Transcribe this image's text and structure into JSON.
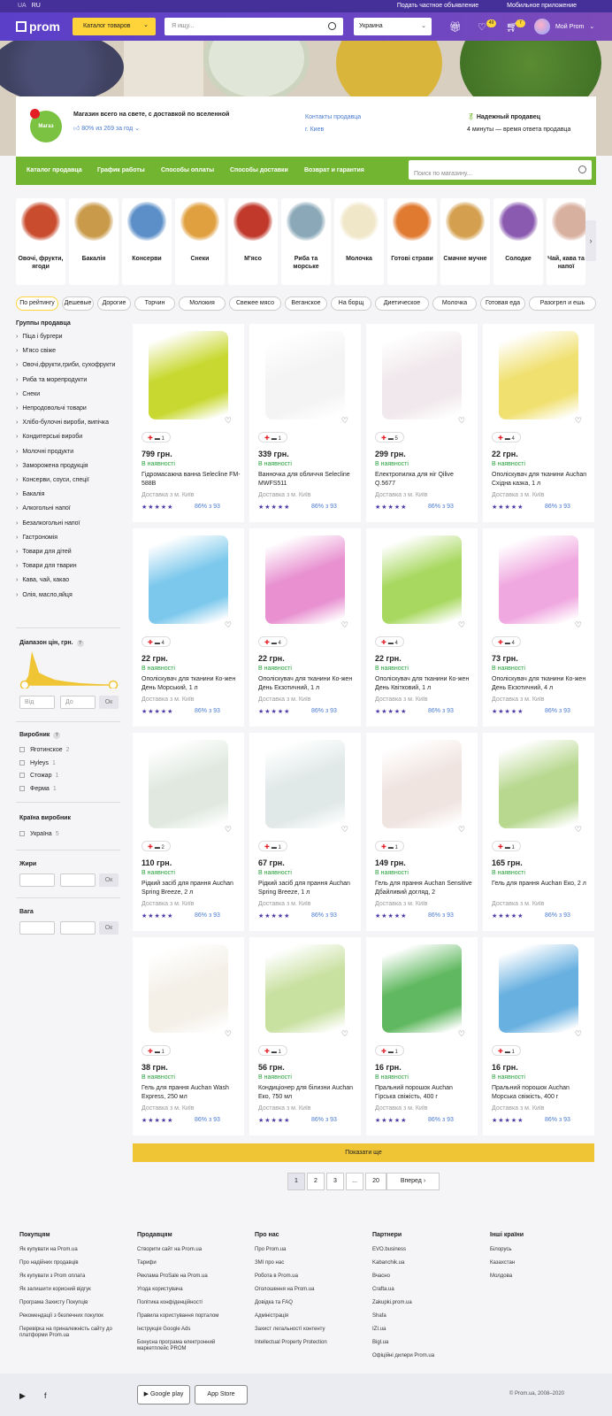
{
  "topbar": {
    "lang": [
      "UA",
      "RU"
    ],
    "sell": "Подать частное объявление",
    "app": "Мобильное приложение"
  },
  "header": {
    "logo": "prom",
    "catalog": "Каталог товаров",
    "search_ph": "Я ищу...",
    "region": "Украина",
    "favorites_count": "49",
    "cart_count": "7",
    "myprom": "Мой Prom"
  },
  "shop": {
    "logo_text": "Магаз",
    "name": "Магазин всего на свете, с доставкой по вселенной",
    "rating": "80% из 269 за год",
    "contacts": "Контакты продавца",
    "city": "г. Киев",
    "trusted": "Надежный продавец",
    "response": "4 минуты — время ответа продавца"
  },
  "shopnav": {
    "items": [
      "Каталог продавца",
      "График работы",
      "Способы оплаты",
      "Способы доставки",
      "Возврат и гарантия"
    ],
    "search_ph": "Поиск по магазину..."
  },
  "categories": [
    {
      "label": "Овочі, фрукти, ягоди",
      "color": "#c94c2e"
    },
    {
      "label": "Бакалія",
      "color": "#c89a4a"
    },
    {
      "label": "Консерви",
      "color": "#5c8fc8"
    },
    {
      "label": "Снеки",
      "color": "#e0a040"
    },
    {
      "label": "М'ясо",
      "color": "#c0392b"
    },
    {
      "label": "Риба та морське",
      "color": "#8aa8b8"
    },
    {
      "label": "Молочка",
      "color": "#f0e6c8"
    },
    {
      "label": "Готові страви",
      "color": "#e07a30"
    },
    {
      "label": "Смачне мучне",
      "color": "#d4a050"
    },
    {
      "label": "Солодке",
      "color": "#8a5ab0"
    },
    {
      "label": "Чай, кава та напої",
      "color": "#d8b0a0"
    }
  ],
  "chips": [
    "По рейтингу",
    "Дешевые",
    "Дорогие",
    "Торчин",
    "Молокия",
    "Свежее мясо",
    "Веганское",
    "На борщ",
    "Диетическое",
    "Молочка",
    "Готовая еда",
    "Разогрел и ешь"
  ],
  "sidebar": {
    "groups_title": "Группы продавца",
    "groups": [
      "Піца і бургери",
      "М'ясо свіже",
      "Овочі,фрукти,гриби, сухофрукти",
      "Риба та морепродукти",
      "Снеки",
      "Непродовольчі товари",
      "Хлібо-булочні вироби, випічка",
      "Кондитерські вироби",
      "Молочні продукти",
      "Заморожена продукція",
      "Консерви, соуси, спеції",
      "Бакалія",
      "Алкогольні напої",
      "Безалкогольні напої",
      "Гастрономія",
      "Товари для дітей",
      "Товари для тварин",
      "Кава, чай, какао",
      "Олія, масло,яйця"
    ],
    "price_title": "Діапазон цін, грн.",
    "from": "Від",
    "to": "До",
    "ok": "Ок",
    "maker_title": "Виробник",
    "makers": [
      {
        "n": "Яготинское",
        "c": "2"
      },
      {
        "n": "Hyleys",
        "c": "1"
      },
      {
        "n": "Стожар",
        "c": "1"
      },
      {
        "n": "Ферма",
        "c": "1"
      }
    ],
    "country_title": "Країна виробник",
    "countries": [
      {
        "n": "Україна",
        "c": "5"
      }
    ],
    "fat_title": "Жири",
    "weight_title": "Вага"
  },
  "products": [
    {
      "price": "799 грн.",
      "name": "Гідромасажна ванна Selecline FM-588B",
      "badge": "1",
      "img": "#c8d830"
    },
    {
      "price": "339 грн.",
      "name": "Ванночка для обличчя Selecline MWFS511",
      "badge": "1",
      "img": "#f4f4f4"
    },
    {
      "price": "299 грн.",
      "name": "Електропилка для ніг Qilive Q.5677",
      "badge": "5",
      "img": "#f0e8ec"
    },
    {
      "price": "22 грн.",
      "name": "Ополіскувач для тканини Auchan Східна казка, 1 л",
      "badge": "4",
      "img": "#f0e070"
    },
    {
      "price": "22 грн.",
      "name": "Ополіскувач для тканини Ко-жен День Морський, 1 л",
      "badge": "4",
      "img": "#7cc8ec"
    },
    {
      "price": "22 грн.",
      "name": "Ополіскувач для тканини Ко-жен День Екзотичний, 1 л",
      "badge": "4",
      "img": "#e890d0"
    },
    {
      "price": "22 грн.",
      "name": "Ополіскувач для тканини Ко-жен День Квітковий, 1 л",
      "badge": "4",
      "img": "#a8d860"
    },
    {
      "price": "73 грн.",
      "name": "Ополіскувач для тканини Ко-жен День Екзотичний, 4 л",
      "badge": "4",
      "img": "#f0a8e0"
    },
    {
      "price": "110 грн.",
      "name": "Рідкий засіб для прання Auchan Spring Breeze, 2 л",
      "badge": "2",
      "img": "#e0e8e0"
    },
    {
      "price": "67 грн.",
      "name": "Рідкий засіб для прання Auchan Spring Breeze, 1 л",
      "badge": "1",
      "img": "#e0e8e8"
    },
    {
      "price": "149 грн.",
      "name": "Гель для прання Auchan Sensitive Дбайливий догляд, 2",
      "badge": "1",
      "img": "#f0e4e0"
    },
    {
      "price": "165 грн.",
      "name": "Гель для прання Auchan Еко, 2 л",
      "badge": "1",
      "img": "#b8d890"
    },
    {
      "price": "38 грн.",
      "name": "Гель для прання Auchan Wash Express, 250 мл",
      "badge": "1",
      "img": "#f4f0e8"
    },
    {
      "price": "56 грн.",
      "name": "Кондиціонер для білизни Auchan Еко, 750 мл",
      "badge": "1",
      "img": "#c8e0a0"
    },
    {
      "price": "16 грн.",
      "name": "Пральний порошок Auchan Гірська свіжість, 400 г",
      "badge": "1",
      "img": "#60b860"
    },
    {
      "price": "16 грн.",
      "name": "Пральний порошок Auchan Морська свіжість, 400 г",
      "badge": "1",
      "img": "#68b0e0"
    }
  ],
  "product_common": {
    "stock": "В наявності",
    "city": "Доставка з м. Київ",
    "stars": "★★★★★",
    "rating": "86% з 93"
  },
  "show_more": "Показати ще",
  "pagination": [
    "1",
    "2",
    "3",
    "...",
    "20"
  ],
  "next": "Вперед",
  "footer": {
    "cols": [
      {
        "title": "Покупцям",
        "links": [
          "Як купувати на Prom.ua",
          "Про надійних продавців",
          "Як купувати з Prom оплата",
          "Як залишити корисний відгук",
          "Програма Захисту Покупців",
          "Рекомендації з безпечних покупок",
          "Перевірка на приналежність сайту до платформи Prom.ua"
        ]
      },
      {
        "title": "Продавцям",
        "links": [
          "Створити сайт на Prom.ua",
          "Тарифи",
          "Реклама ProSale на Prom.ua",
          "Угода користувача",
          "Політика конфіденційності",
          "Правила користування порталом",
          "Інструкція Google Ads",
          "Бонусна програма електронний маркетплейс PROM"
        ]
      },
      {
        "title": "Про нас",
        "links": [
          "Про Prom.ua",
          "ЗМІ про нас",
          "Робота в Prom.ua",
          "Оголошення на Prom.ua",
          "Довідка та FAQ",
          "Адміністрація",
          "Захист легальності контенту",
          "Intellectual Property Protection"
        ]
      },
      {
        "title": "Партнери",
        "links": [
          "EVO.business",
          "Kabanchik.ua",
          "Вчасно",
          "Crafta.ua",
          "Zakupki.prom.ua",
          "Shafa",
          "IZI.ua",
          "Bigl.ua",
          "Офіційні дилери Prom.ua"
        ]
      },
      {
        "title": "Інші країни",
        "links": [
          "Білорусь",
          "Казахстан",
          "Молдова"
        ]
      }
    ],
    "google": "Google play",
    "apple": "App Store",
    "copyright": "© Prom.ua, 2008–2020"
  }
}
